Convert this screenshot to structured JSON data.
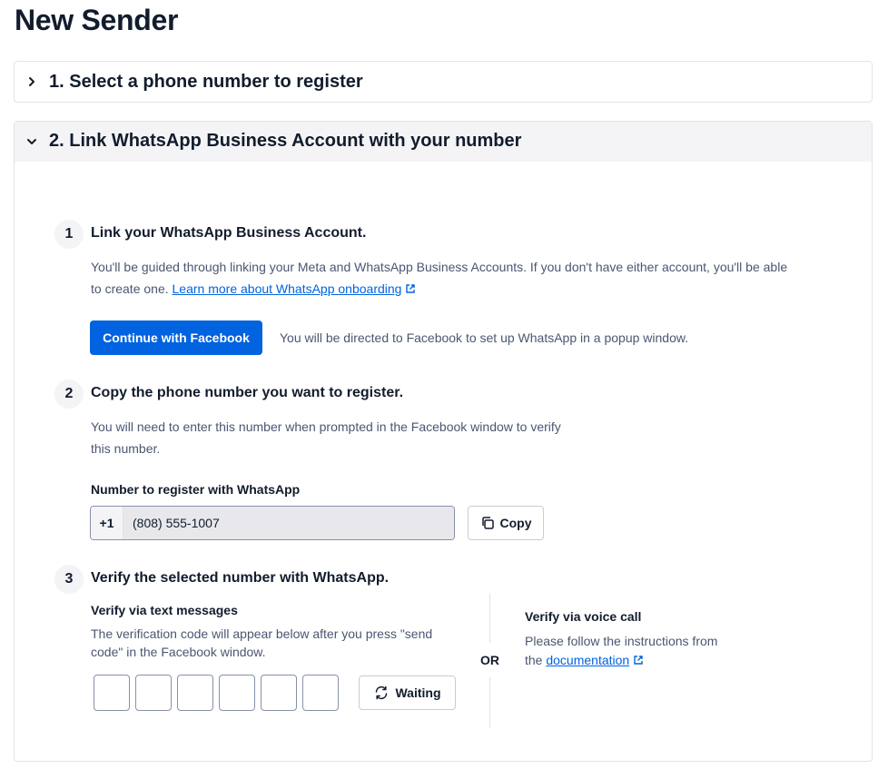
{
  "page": {
    "title": "New Sender"
  },
  "section1": {
    "title": "1. Select a phone number to register",
    "expanded": false
  },
  "section2": {
    "title": "2. Link WhatsApp Business Account with your number",
    "expanded": true
  },
  "steps": {
    "step1": {
      "number": "1",
      "title": "Link your WhatsApp Business Account.",
      "desc_line1": "You'll be guided through linking your Meta and WhatsApp Business Accounts. If you don't have either account, you'll be able",
      "desc_line2": "to create one.",
      "link_text": "Learn more about WhatsApp onboarding",
      "button_label": "Continue with Facebook",
      "button_note": "You will be directed to Facebook to set up WhatsApp in a popup window."
    },
    "step2": {
      "number": "2",
      "title": "Copy the phone number you want to register.",
      "desc_line1": "You will need to enter this number when prompted in the Facebook window to verify",
      "desc_line2": "this number.",
      "field_label": "Number to register with WhatsApp",
      "country_code": "+1",
      "phone_number": "(808) 555-1007",
      "copy_label": "Copy"
    },
    "step3": {
      "number": "3",
      "title": "Verify the selected number with WhatsApp.",
      "sms": {
        "title": "Verify via text messages",
        "desc_line1": "The verification code will appear below after you press \"send",
        "desc_line2": "code\" in the Facebook window.",
        "code_digits": [
          "",
          "",
          "",
          "",
          "",
          ""
        ],
        "waiting_label": "Waiting"
      },
      "or_label": "OR",
      "voice": {
        "title": "Verify via voice call",
        "desc_line1": "Please follow the instructions from",
        "desc_prefix": "the",
        "link_text": "documentation"
      }
    }
  },
  "colors": {
    "primary": "#0263e0",
    "text": "#121c2d",
    "muted": "#4b5671",
    "border": "#e1e3ea",
    "header_bg": "#f4f4f6"
  },
  "icons": [
    "chevron-right-icon",
    "chevron-down-icon",
    "external-link-icon",
    "copy-icon",
    "refresh-icon"
  ]
}
